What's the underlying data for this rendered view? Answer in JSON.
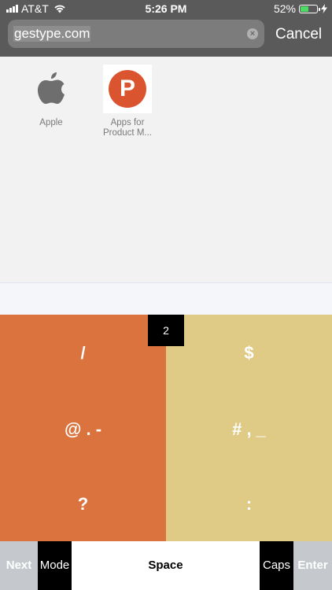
{
  "status_bar": {
    "carrier": "AT&T",
    "time": "5:26 PM",
    "battery_percent": "52%",
    "battery_level": 0.52,
    "icons": [
      "signal-icon",
      "wifi-icon",
      "battery-icon",
      "charging-bolt-icon"
    ]
  },
  "search": {
    "url": "gestype.com",
    "cancel_label": "Cancel"
  },
  "favorites": [
    {
      "label": "Apple",
      "icon": "apple-logo-icon"
    },
    {
      "label": "Apps for Product M...",
      "label_line1": "Apps for",
      "label_line2": "Product M...",
      "icon": "product-hunt-logo-icon",
      "logo_letter": "P"
    }
  ],
  "keyboard": {
    "page_indicator": "2",
    "left_panel": {
      "top": "/",
      "middle": "@ . -",
      "bottom": "?"
    },
    "right_panel": {
      "top": "$",
      "middle": "# , _",
      "bottom": ":"
    },
    "bottom_row": {
      "next": "Next",
      "mode": "Mode",
      "space": "Space",
      "caps": "Caps",
      "enter": "Enter"
    }
  },
  "colors": {
    "header_bg": "#5a5a5a",
    "left_panel": "#db733f",
    "right_panel": "#dfcb85",
    "product_hunt": "#da552f",
    "battery_fill": "#4cd964"
  }
}
